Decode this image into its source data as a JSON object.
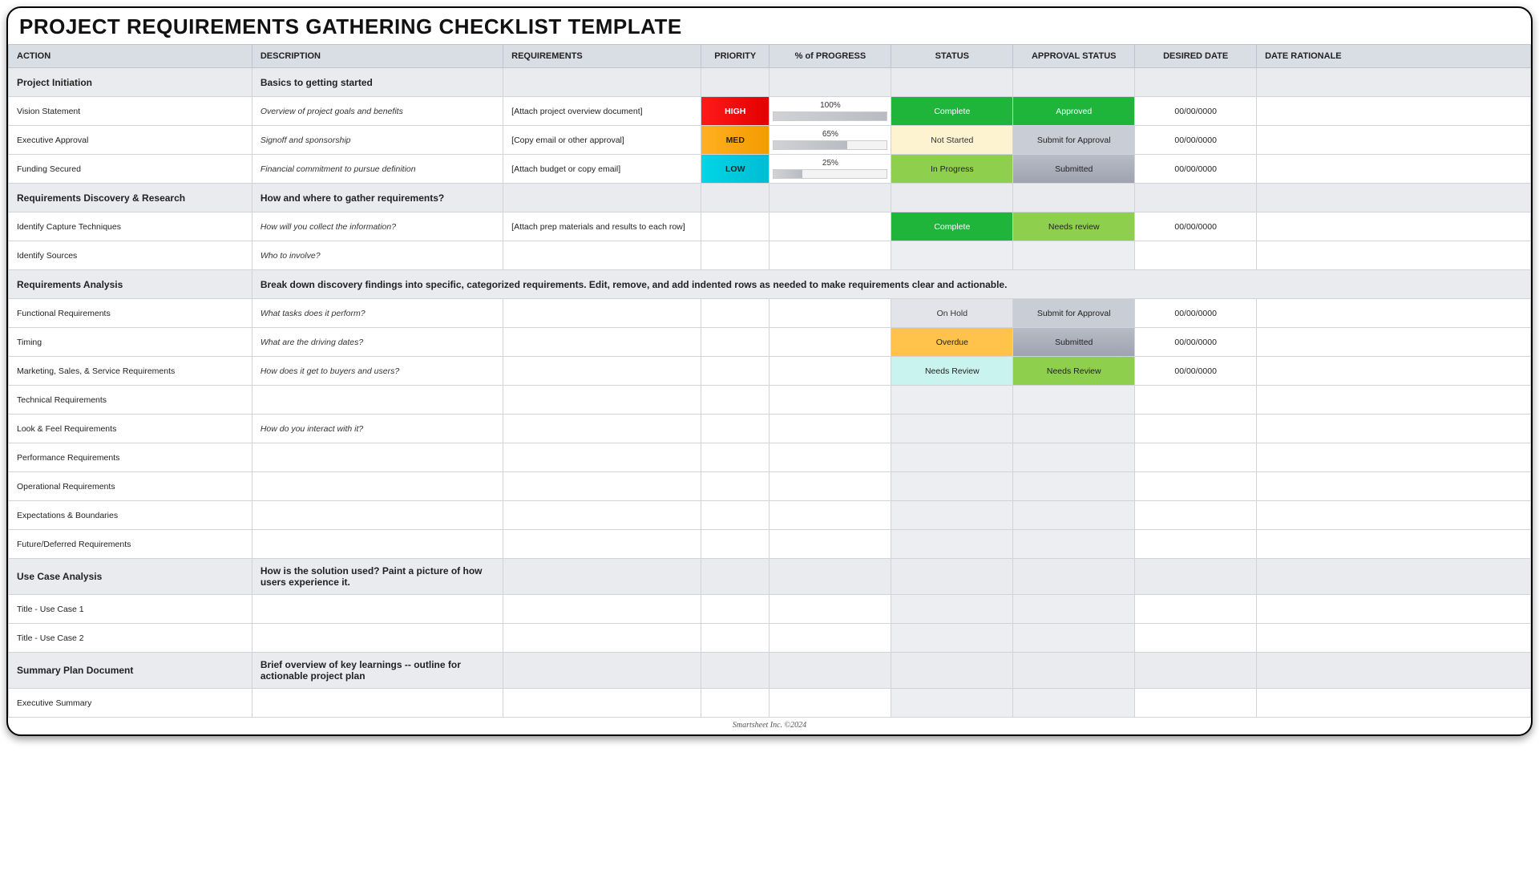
{
  "title": "PROJECT REQUIREMENTS GATHERING CHECKLIST TEMPLATE",
  "footer": "Smartsheet Inc. ©2024",
  "columns": [
    "ACTION",
    "DESCRIPTION",
    "REQUIREMENTS",
    "PRIORITY",
    "% of PROGRESS",
    "STATUS",
    "APPROVAL STATUS",
    "DESIRED DATE",
    "DATE RATIONALE"
  ],
  "rows": [
    {
      "type": "section",
      "action": "Project Initiation",
      "description": "Basics to getting started"
    },
    {
      "type": "data",
      "action": "Vision Statement",
      "description": "Overview of project goals and benefits",
      "requirements": "[Attach project overview document]",
      "priority": "HIGH",
      "priorityClass": "priority-high",
      "progress": 100,
      "status": "Complete",
      "statusClass": "status-complete",
      "approval": "Approved",
      "approvalClass": "approval-approved",
      "date": "00/00/0000"
    },
    {
      "type": "data",
      "action": "Executive Approval",
      "description": "Signoff and sponsorship",
      "requirements": "[Copy email or other approval]",
      "priority": "MED",
      "priorityClass": "priority-med",
      "progress": 65,
      "status": "Not Started",
      "statusClass": "status-notstarted",
      "approval": "Submit for Approval",
      "approvalClass": "approval-submitfa",
      "date": "00/00/0000"
    },
    {
      "type": "data",
      "action": "Funding Secured",
      "description": "Financial commitment to pursue definition",
      "requirements": "[Attach budget or copy email]",
      "priority": "LOW",
      "priorityClass": "priority-low",
      "progress": 25,
      "status": "In Progress",
      "statusClass": "status-inprogress",
      "approval": "Submitted",
      "approvalClass": "approval-submitted",
      "date": "00/00/0000"
    },
    {
      "type": "section",
      "action": "Requirements Discovery & Research",
      "description": "How and where to gather requirements?"
    },
    {
      "type": "data",
      "action": "Identify Capture Techniques",
      "description": "How will you collect the information?",
      "requirements": "[Attach prep materials and results to each row]",
      "status": "Complete",
      "statusClass": "status-complete",
      "approval": "Needs review",
      "approvalClass": "approval-needrev",
      "date": "00/00/0000"
    },
    {
      "type": "data",
      "action": "Identify Sources",
      "description": "Who to involve?",
      "statusClass": "faint",
      "approvalClass": "faint"
    },
    {
      "type": "section",
      "action": "Requirements Analysis",
      "description": "Break down discovery findings into specific, categorized requirements. Edit, remove, and add indented rows as needed to make requirements clear and actionable.",
      "descSpan": 8
    },
    {
      "type": "data",
      "action": "Functional Requirements",
      "description": "What tasks does it perform?",
      "status": "On Hold",
      "statusClass": "status-onhold",
      "approval": "Submit for Approval",
      "approvalClass": "approval-submitfa",
      "date": "00/00/0000"
    },
    {
      "type": "data",
      "action": "Timing",
      "description": "What are the driving dates?",
      "status": "Overdue",
      "statusClass": "status-overdue",
      "approval": "Submitted",
      "approvalClass": "approval-submitted",
      "date": "00/00/0000"
    },
    {
      "type": "data",
      "action": "Marketing, Sales, & Service Requirements",
      "description": "How does it get to buyers and users?",
      "status": "Needs Review",
      "statusClass": "status-needsrev",
      "approval": "Needs Review",
      "approvalClass": "approval-needrev2",
      "date": "00/00/0000"
    },
    {
      "type": "data",
      "action": "Technical Requirements",
      "statusClass": "faint",
      "approvalClass": "faint"
    },
    {
      "type": "data",
      "action": "Look & Feel Requirements",
      "description": "How do you interact with it?",
      "statusClass": "faint",
      "approvalClass": "faint"
    },
    {
      "type": "data",
      "action": "Performance Requirements",
      "statusClass": "faint",
      "approvalClass": "faint"
    },
    {
      "type": "data",
      "action": "Operational Requirements",
      "statusClass": "faint",
      "approvalClass": "faint"
    },
    {
      "type": "data",
      "action": "Expectations & Boundaries",
      "statusClass": "faint",
      "approvalClass": "faint"
    },
    {
      "type": "data",
      "action": "Future/Deferred Requirements",
      "statusClass": "faint",
      "approvalClass": "faint"
    },
    {
      "type": "section",
      "action": "Use Case Analysis",
      "description": "How is the solution used? Paint a picture of how users experience it."
    },
    {
      "type": "data",
      "action": "Title - Use Case 1",
      "statusClass": "faint",
      "approvalClass": "faint"
    },
    {
      "type": "data",
      "action": "Title - Use Case 2",
      "statusClass": "faint",
      "approvalClass": "faint"
    },
    {
      "type": "section",
      "action": "Summary Plan Document",
      "description": "Brief overview of key learnings -- outline for actionable project plan"
    },
    {
      "type": "data",
      "action": "Executive Summary",
      "statusClass": "faint",
      "approvalClass": "faint"
    }
  ]
}
